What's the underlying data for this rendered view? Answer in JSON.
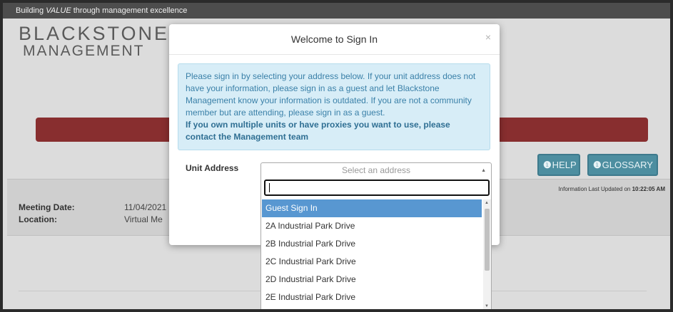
{
  "page": {
    "tagline_prefix": "Building ",
    "tagline_emph": "VALUE",
    "tagline_suffix": " through management excellence",
    "logo_line1": "BLACKSTONE",
    "logo_line2": "MANAGEMENT",
    "help_label": "HELP",
    "glossary_label": "GLOSSARY",
    "updated_prefix": "Information Last Updated on ",
    "updated_time": "10:22:05 AM",
    "meeting_date_label": "Meeting Date:",
    "meeting_date_value": "11/04/2021",
    "location_label": "Location:",
    "location_value": "Virtual Me"
  },
  "modal": {
    "title": "Welcome to Sign In",
    "close": "×",
    "alert_text": "Please sign in by selecting your address below. If your unit address does not have your information, please sign in as a guest and let Blackstone Management know your information is outdated. If you are not a community member but are attending, please sign in as a guest.",
    "alert_bold": "If you own multiple units or have proxies you want to use, please contact the Management team",
    "unit_address_label": "Unit Address"
  },
  "select": {
    "placeholder": "Select an address",
    "search_value": "",
    "options": [
      "Guest Sign In",
      "2A Industrial Park Drive",
      "2B Industrial Park Drive",
      "2C Industrial Park Drive",
      "2D Industrial Park Drive",
      "2E Industrial Park Drive"
    ],
    "highlighted_index": 0
  },
  "colors": {
    "header_bar": "#4d4d4d",
    "red_bar": "#7e1b1c",
    "button_teal": "#4d8ea0",
    "alert_bg": "#d7edf7",
    "alert_text": "#3a80a8",
    "highlight": "#5897d1"
  },
  "icons": {
    "info": "info-circle-icon",
    "close": "close-icon",
    "dropdown_arrow": "triangle-up-icon"
  }
}
